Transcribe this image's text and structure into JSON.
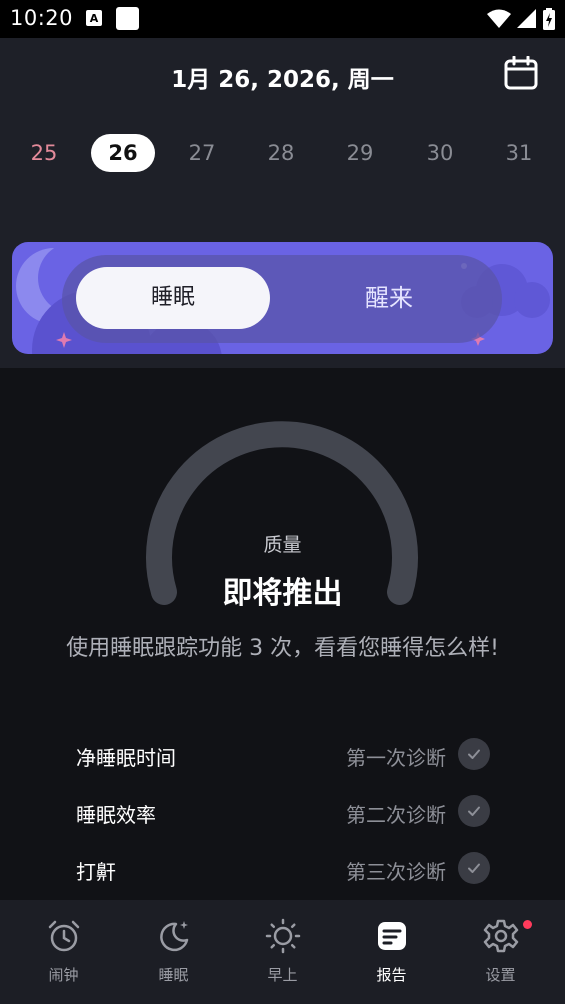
{
  "status_bar": {
    "time": "10:20"
  },
  "header": {
    "date_title": "1月 26, 2026, 周一",
    "week_days": [
      {
        "label": "25",
        "state": "past"
      },
      {
        "label": "26",
        "state": "selected"
      },
      {
        "label": "27",
        "state": "future"
      },
      {
        "label": "28",
        "state": "future"
      },
      {
        "label": "29",
        "state": "future"
      },
      {
        "label": "30",
        "state": "future"
      },
      {
        "label": "31",
        "state": "future"
      }
    ]
  },
  "mode_toggle": {
    "sleep_label": "睡眠",
    "wake_label": "醒来",
    "selected": "sleep"
  },
  "report": {
    "quality_label": "质量",
    "quality_value": "即将推出",
    "description": "使用睡眠跟踪功能 3 次，看看您睡得怎么样!",
    "metrics": [
      {
        "label": "净睡眠时间",
        "status": "第一次诊断"
      },
      {
        "label": "睡眠效率",
        "status": "第二次诊断"
      },
      {
        "label": "打鼾",
        "status": "第三次诊断"
      }
    ]
  },
  "bottom_nav": {
    "items": [
      {
        "label": "闹钟",
        "icon": "alarm-clock-icon"
      },
      {
        "label": "睡眠",
        "icon": "moon-icon"
      },
      {
        "label": "早上",
        "icon": "sun-icon"
      },
      {
        "label": "报告",
        "icon": "report-icon",
        "active": true
      },
      {
        "label": "设置",
        "icon": "gear-icon",
        "badge": true
      }
    ]
  },
  "colors": {
    "accent": "#6a63e4",
    "background": "#111216",
    "header_bg": "#1e2028",
    "past_day": "#e38a9a",
    "notification": "#ff3b5c"
  }
}
